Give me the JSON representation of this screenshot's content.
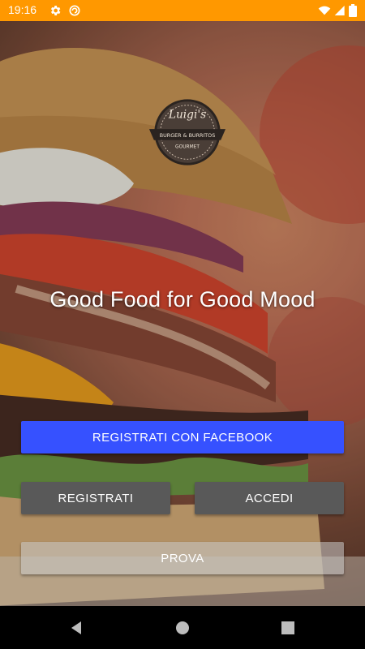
{
  "status_bar": {
    "time": "19:16",
    "icons": [
      "gear-icon",
      "sync-icon",
      "wifi-icon",
      "signal-icon",
      "battery-icon"
    ],
    "color": "#FF9800"
  },
  "logo": {
    "text_top": "Luigi's",
    "text_mid": "BURGER & BURRITOS",
    "text_bottom": "GOURMET"
  },
  "tagline": "Good Food for Good Mood",
  "buttons": {
    "facebook": "REGISTRATI CON FACEBOOK",
    "register": "REGISTRATI",
    "login": "ACCEDI",
    "try": "PROVA"
  },
  "colors": {
    "facebook": "#3651FF",
    "secondary": "#595959",
    "try": "rgba(200,200,200,0.55)"
  },
  "nav_bar": {
    "icons": [
      "back-icon",
      "home-icon",
      "recent-apps-icon"
    ]
  }
}
